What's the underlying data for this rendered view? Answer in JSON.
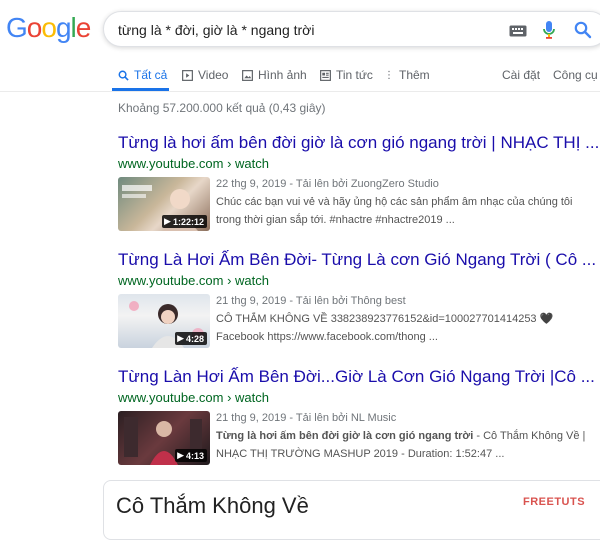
{
  "logo": {
    "letters": [
      "G",
      "o",
      "o",
      "g",
      "l",
      "e"
    ]
  },
  "search": {
    "query": "từng là * đời, giờ là * ngang trời"
  },
  "tabs": [
    {
      "label": "Tất cả",
      "icon": "search-icon"
    },
    {
      "label": "Video",
      "icon": "video-icon"
    },
    {
      "label": "Hình ảnh",
      "icon": "image-icon"
    },
    {
      "label": "Tin tức",
      "icon": "news-icon"
    },
    {
      "label": "Thêm",
      "icon": "more-icon"
    }
  ],
  "tools": {
    "settings": "Cài đặt",
    "tools": "Công cụ"
  },
  "stats": "Khoảng 57.200.000 kết quả (0,43 giây)",
  "results": [
    {
      "title": "Từng là hơi ấm bên đời giờ là cơn gió ngang trời | NHẠC THỊ ...",
      "url": "www.youtube.com › watch",
      "date": "22 thg 9, 2019 - Tải lên bởi ZuongZero Studio",
      "snippet1": "Chúc các bạn vui vẻ và hãy ủng hộ các sản phẩm âm nhạc của chúng tôi",
      "snippet2": "trong thời gian sắp tới. #nhactre #nhactre2019 ...",
      "duration": "1:22:12"
    },
    {
      "title": "Từng Là Hơi Ấm Bên Đời- Từng Là cơn Gió Ngang Trời ( Cô ...",
      "url": "www.youtube.com › watch",
      "date": "21 thg 9, 2019 - Tải lên bởi Thông best",
      "snippet1": "CÔ THẮM KHÔNG VỀ 338238923776152&id=100027701414253 🖤",
      "snippet2": "Facebook https://www.facebook.com/thong ...",
      "duration": "4:28"
    },
    {
      "title": "Từng Làn Hơi Ấm Bên Đời...Giờ Là Cơn Gió Ngang Trời |Cô ...",
      "url": "www.youtube.com › watch",
      "date": "21 thg 9, 2019 - Tải lên bởi NL Music",
      "snippet1_bold": "Từng là hơi ấm bên đời giờ là cơn gió ngang trời",
      "snippet1_rest": " - Cô Thắm Không Về |",
      "snippet2": "NHẠC THỊ TRƯỜNG MASHUP 2019 - Duration: 1:52:47 ...",
      "duration": "4:13"
    }
  ],
  "knowledge_panel": {
    "title": "Cô Thắm Không Về"
  },
  "watermark": "FREETUTS",
  "colors": {
    "link": "#1a0dab",
    "url": "#006621",
    "accent": "#1a73e8"
  }
}
